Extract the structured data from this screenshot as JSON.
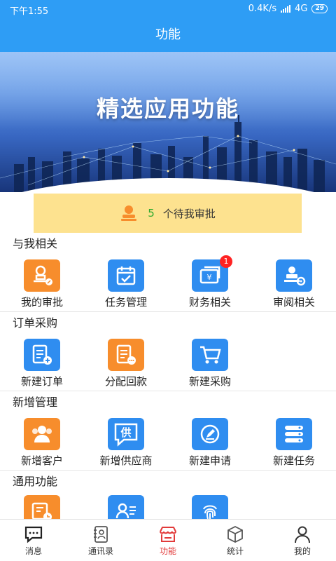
{
  "status_bar": {
    "time": "下午1:55",
    "network_speed": "0.4K/s",
    "network_type": "4G",
    "battery": "29"
  },
  "header": {
    "title": "功能"
  },
  "banner": {
    "title": "精选应用功能"
  },
  "pending": {
    "count": "5",
    "text": "个待我审批",
    "icon": "approver-stamp-icon"
  },
  "sections": [
    {
      "title": "与我相关",
      "items": [
        {
          "label": "我的审批",
          "icon": "approval-stamp-icon",
          "color": "#f78d2c"
        },
        {
          "label": "任务管理",
          "icon": "calendar-check-icon",
          "color": "#2f8df0"
        },
        {
          "label": "财务相关",
          "icon": "money-bill-icon",
          "color": "#2f8df0",
          "badge": "1"
        },
        {
          "label": "审阅相关",
          "icon": "stamp-gear-icon",
          "color": "#2f8df0"
        }
      ]
    },
    {
      "title": "订单采购",
      "items": [
        {
          "label": "新建订单",
          "icon": "order-add-icon",
          "color": "#2f8df0"
        },
        {
          "label": "分配回款",
          "icon": "document-more-icon",
          "color": "#f78d2c"
        },
        {
          "label": "新建采购",
          "icon": "shopping-cart-icon",
          "color": "#2f8df0"
        }
      ]
    },
    {
      "title": "新增管理",
      "items": [
        {
          "label": "新增客户",
          "icon": "customers-icon",
          "color": "#f78d2c"
        },
        {
          "label": "新增供应商",
          "icon": "supplier-chat-icon",
          "color": "#2f8df0",
          "glyph": "供"
        },
        {
          "label": "新建申请",
          "icon": "edit-request-icon",
          "color": "#2f8df0"
        },
        {
          "label": "新建任务",
          "icon": "task-list-icon",
          "color": "#2f8df0"
        }
      ]
    },
    {
      "title": "通用功能",
      "items": [
        {
          "label": "",
          "icon": "attendance-clock-icon",
          "color": "#f78d2c"
        },
        {
          "label": "",
          "icon": "contact-card-icon",
          "color": "#2f8df0"
        },
        {
          "label": "",
          "icon": "fingerprint-icon",
          "color": "#2f8df0"
        }
      ]
    }
  ],
  "nav": [
    {
      "label": "消息",
      "icon": "message-icon"
    },
    {
      "label": "通讯录",
      "icon": "contacts-book-icon"
    },
    {
      "label": "功能",
      "icon": "store-icon",
      "active": true
    },
    {
      "label": "统计",
      "icon": "cube-icon"
    },
    {
      "label": "我的",
      "icon": "profile-icon"
    }
  ]
}
